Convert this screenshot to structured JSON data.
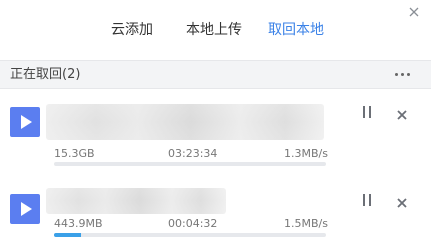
{
  "tabs": [
    {
      "label": "云添加"
    },
    {
      "label": "本地上传"
    },
    {
      "label": "取回本地"
    }
  ],
  "section": {
    "title": "正在取回(2)"
  },
  "icons": {
    "close": "close-icon",
    "more": "more-icon",
    "play": "play-icon",
    "pause": "pause-icon",
    "remove": "close-icon"
  },
  "colors": {
    "accent": "#3b82e7",
    "play": "#5b7ef0",
    "progress": "#3aa0e8"
  },
  "downloads": [
    {
      "size": "15.3GB",
      "time": "03:23:34",
      "speed": "1.3MB/s",
      "progress": 0
    },
    {
      "size": "443.9MB",
      "time": "00:04:32",
      "speed": "1.5MB/s",
      "progress": 0.1
    }
  ]
}
